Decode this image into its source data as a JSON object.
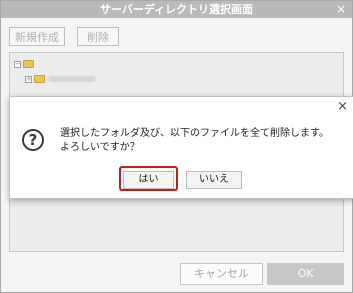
{
  "window": {
    "title": "サーバーディレクトリ選択画面",
    "close_glyph": "×"
  },
  "toolbar": {
    "new_label": "新規作成",
    "delete_label": "削除"
  },
  "footer": {
    "cancel_label": "キャンセル",
    "ok_label": "OK"
  },
  "dialog": {
    "close_glyph": "×",
    "icon_glyph": "?",
    "message_line1": "選択したフォルダ及び、以下のファイルを全て削除します。",
    "message_line2": "よろしいですか？",
    "yes_label": "はい",
    "no_label": "いいえ"
  },
  "colors": {
    "highlight": "#cc1a1a",
    "ok_bg": "#c7c7c7",
    "title_bg": "#b9b9b9"
  }
}
